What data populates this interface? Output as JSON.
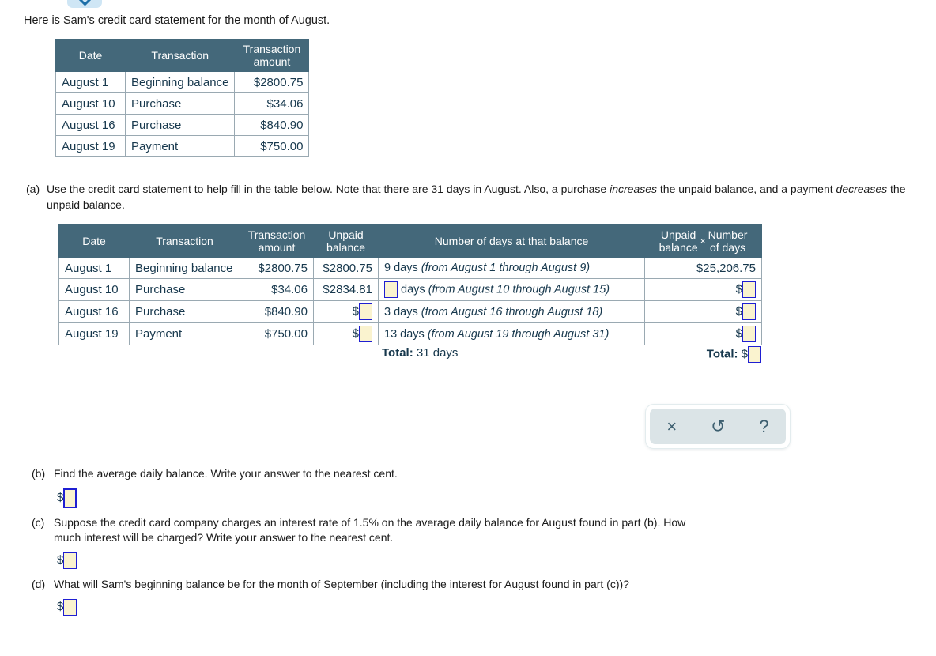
{
  "top_control": {
    "icon": "chevron-down-icon"
  },
  "intro": "Here is Sam's credit card statement for the month of August.",
  "statement_table": {
    "headers": [
      "Date",
      "Transaction",
      "Transaction amount"
    ],
    "header_transaction_amount_line1": "Transaction",
    "header_transaction_amount_line2": "amount",
    "rows": [
      {
        "date": "August 1",
        "transaction": "Beginning balance",
        "amount": "$2800.75"
      },
      {
        "date": "August 10",
        "transaction": "Purchase",
        "amount": "$34.06"
      },
      {
        "date": "August 16",
        "transaction": "Purchase",
        "amount": "$840.90"
      },
      {
        "date": "August 19",
        "transaction": "Payment",
        "amount": "$750.00"
      }
    ]
  },
  "part_a": {
    "label": "(a)",
    "text_1": "Use the credit card statement to help fill in the table below. Note that there are 31 days in August. Also, a purchase ",
    "em_1": "increases",
    "text_2": " the unpaid balance, and a payment ",
    "em_2": "decreases",
    "text_3": " the unpaid balance.",
    "table": {
      "headers": {
        "date": "Date",
        "transaction": "Transaction",
        "transaction_amount_l1": "Transaction",
        "transaction_amount_l2": "amount",
        "unpaid_balance_l1": "Unpaid",
        "unpaid_balance_l2": "balance",
        "number_of_days": "Number of days at that balance",
        "product_l1": "Unpaid",
        "product_l2": "balance",
        "product_times": "×",
        "product_r1": "Number",
        "product_r2": "of days"
      },
      "rows": [
        {
          "date": "August 1",
          "transaction": "Beginning balance",
          "amount": "$2800.75",
          "unpaid_balance": "$2800.75",
          "unpaid_is_input": false,
          "days_value": "9",
          "days_is_input": false,
          "days_word": " days ",
          "days_range": "(from August 1 through August 9)",
          "product": "$25,206.75",
          "product_is_input": false
        },
        {
          "date": "August 10",
          "transaction": "Purchase",
          "amount": "$34.06",
          "unpaid_balance": "$2834.81",
          "unpaid_is_input": false,
          "days_value": "",
          "days_is_input": true,
          "days_word": " days ",
          "days_range": "(from August 10 through August 15)",
          "product": "",
          "product_is_input": true
        },
        {
          "date": "August 16",
          "transaction": "Purchase",
          "amount": "$840.90",
          "unpaid_balance": "",
          "unpaid_is_input": true,
          "days_value": "3",
          "days_is_input": false,
          "days_word": " days ",
          "days_range": "(from August 16 through August 18)",
          "product": "",
          "product_is_input": true
        },
        {
          "date": "August 19",
          "transaction": "Payment",
          "amount": "$750.00",
          "unpaid_balance": "",
          "unpaid_is_input": true,
          "days_value": "13",
          "days_is_input": false,
          "days_word": " days ",
          "days_range": "(from August 19 through August 31)",
          "product": "",
          "product_is_input": true
        }
      ],
      "totals": {
        "days_label": "Total:",
        "days_value": "31 days",
        "product_label": "Total:",
        "product_currency": "$",
        "product_value": ""
      }
    }
  },
  "toolbar": {
    "clear_icon": "×",
    "clear_name": "clear-button",
    "undo_icon": "↺",
    "undo_name": "undo-button",
    "help_icon": "?",
    "help_name": "help-button"
  },
  "part_b": {
    "label": "(b)",
    "text": "Find the average daily balance. Write your answer to the nearest cent.",
    "currency": "$",
    "value": ""
  },
  "part_c": {
    "label": "(c)",
    "text": "Suppose the credit card company charges an interest rate of 1.5% on the average daily balance for August found in part (b). How much interest will be charged? Write your answer to the nearest cent.",
    "currency": "$",
    "value": ""
  },
  "part_d": {
    "label": "(d)",
    "text": "What will Sam's beginning balance be for the month of September (including the interest for August found in part (c))?",
    "currency": "$",
    "value": ""
  },
  "colors": {
    "table_header_bg": "#44687a",
    "input_fill": "#faf3cf",
    "input_border": "#1f1fd2",
    "toolbar_bg": "#dbe4e7",
    "chevron_bg": "#cfe6f5"
  }
}
